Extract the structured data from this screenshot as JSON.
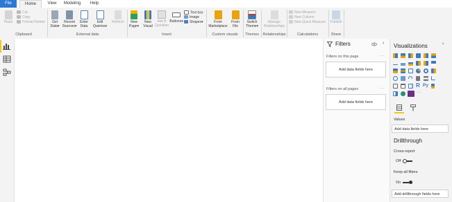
{
  "colors": {
    "file_tab": "#2b79d4",
    "accent": "#f2c811",
    "ribbon_bg": "#f3f3f3"
  },
  "menu": {
    "file": "File",
    "home": "Home",
    "view": "View",
    "modeling": "Modeling",
    "help": "Help"
  },
  "clipboard": {
    "paste": "Paste",
    "cut": "Cut",
    "copy": "Copy",
    "format_painter": "Format Painter",
    "label": "Clipboard"
  },
  "external": {
    "get_data": [
      "Get",
      "Data"
    ],
    "recent_sources": [
      "Recent",
      "Sources"
    ],
    "enter_data": [
      "Enter",
      "Data"
    ],
    "edit_queries": [
      "Edit",
      "Queries"
    ],
    "refresh": "Refresh",
    "label": "External data"
  },
  "insert": {
    "new_page": [
      "New",
      "Page"
    ],
    "new_visual": [
      "New",
      "Visual"
    ],
    "ask_question": [
      "Ask A",
      "Question"
    ],
    "buttons": "Buttons",
    "text_box": "Text box",
    "image": "Image",
    "shapes": "Shapes",
    "label": "Insert"
  },
  "custom_visuals": {
    "from_marketplace": [
      "From",
      "Marketplace"
    ],
    "from_file": [
      "From",
      "File"
    ],
    "label": "Custom visuals"
  },
  "themes": {
    "switch_theme": [
      "Switch",
      "Theme"
    ],
    "label": "Themes"
  },
  "relationships": {
    "manage": [
      "Manage",
      "Relationships"
    ],
    "label": "Relationships"
  },
  "calculations": {
    "new_measure": "New Measure",
    "new_column": "New Column",
    "new_quick_measure": "New Quick Measure",
    "label": "Calculations"
  },
  "share": {
    "publish": "Publish",
    "label": "Share"
  },
  "filters": {
    "title": "Filters",
    "on_this_page": "Filters on this page",
    "on_all_pages": "Filters on all pages",
    "add_fields": "Add data fields here",
    "more": "···"
  },
  "visualizations": {
    "title": "Visualizations",
    "more": "···",
    "values_label": "Values",
    "values_well": "Add data fields here",
    "drillthrough": "Drillthrough",
    "cross_report": "Cross-report",
    "cross_report_state": "Off",
    "keep_filters": "Keep all filters",
    "keep_filters_state": "On",
    "drill_well": "Add drillthrough fields here",
    "icon_R": "R",
    "icon_Py": "Py"
  }
}
